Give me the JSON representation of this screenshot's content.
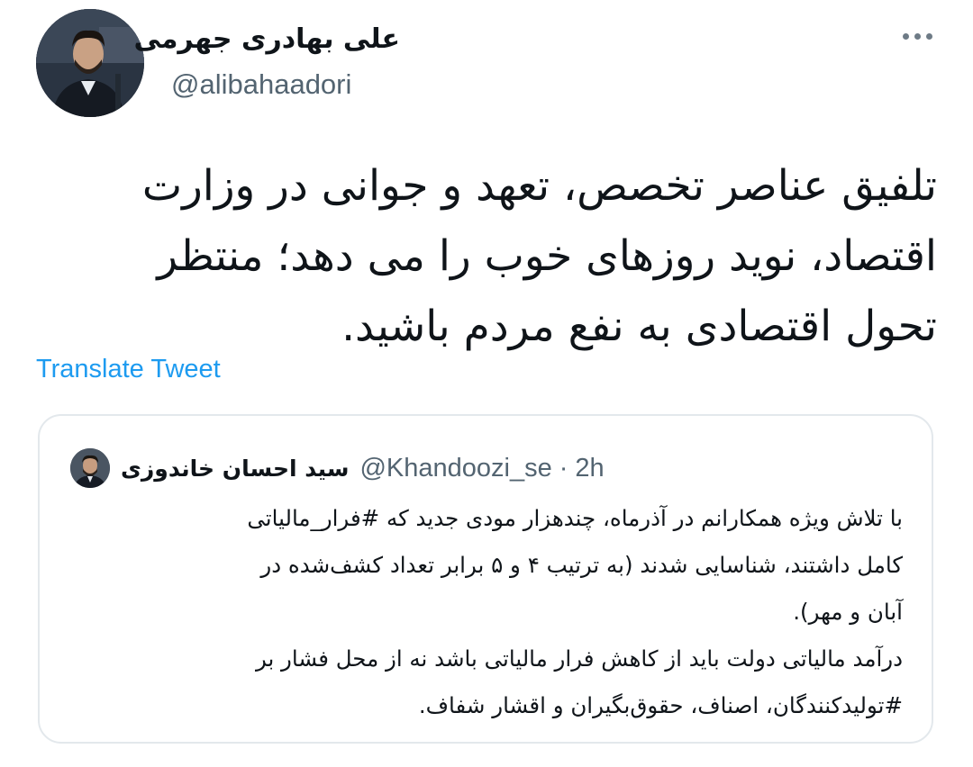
{
  "author": {
    "display_name": "علی بهادری جهرمی",
    "handle": "@alibahaadori",
    "avatar_icon": "profile-photo",
    "more_icon": "more-horizontal-icon"
  },
  "tweet": {
    "lines": [
      "تلفیق عناصر تخصص، تعهد و جوانی در وزارت",
      "اقتصاد، نوید روزهای خوب را می دهد؛ منتظر",
      "تحول اقتصادی به نفع مردم باشید."
    ],
    "translate_label": "Translate Tweet"
  },
  "quoted_tweet": {
    "display_name": "سید احسان خاندوزی",
    "handle": "@Khandoozi_se",
    "separator": "·",
    "time": "2h",
    "lines": [
      "با تلاش ویژه همکارانم در آذرماه، چندهزار مودی جدید که #فرار_مالیاتی",
      "کامل داشتند، شناسایی شدند (به ترتیب ۴ و ۵ برابر تعداد کشف‌شده در",
      "آبان و مهر).",
      "درآمد مالیاتی دولت باید از کاهش فرار مالیاتی باشد نه از محل فشار بر",
      "#تولیدکنندگان، اصناف، حقوق‌بگیران و اقشار شفاف."
    ]
  },
  "colors": {
    "text": "#0f1419",
    "secondary": "#536471",
    "link": "#1d9bf0",
    "border": "#e3e8ec"
  }
}
